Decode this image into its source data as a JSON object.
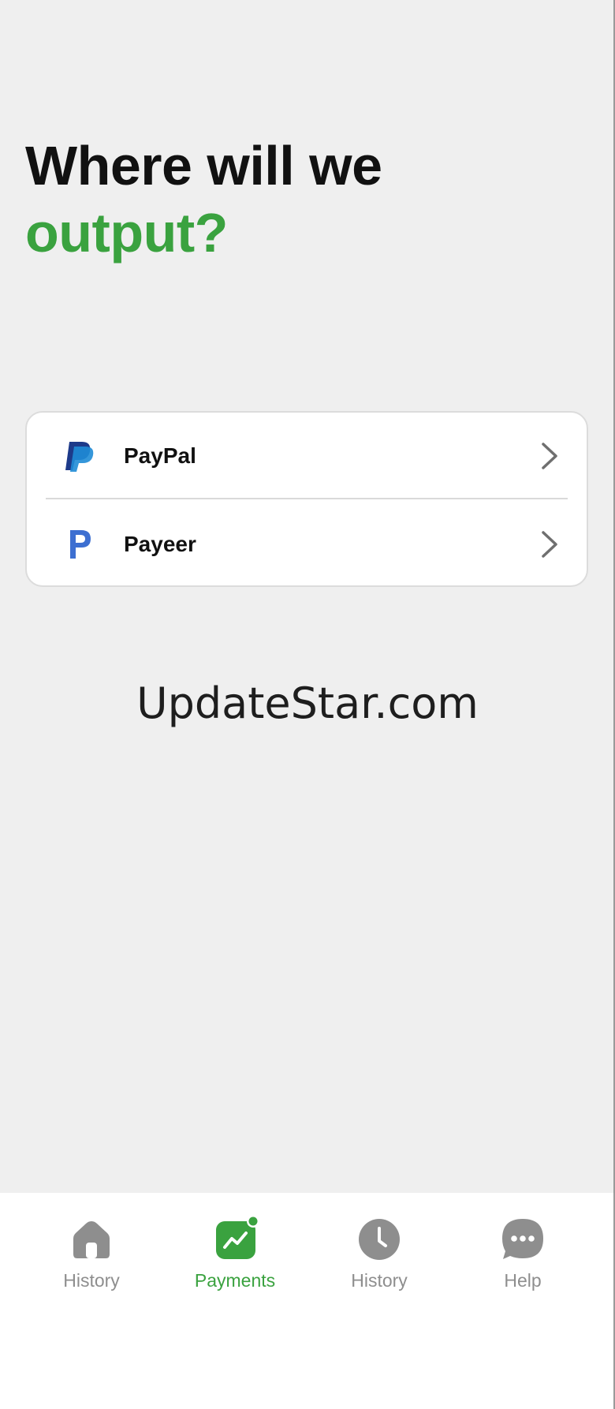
{
  "headline": {
    "line1": "Where will we",
    "line2": "output?"
  },
  "payment_methods": [
    {
      "label": "PayPal",
      "icon": "paypal-logo-icon"
    },
    {
      "label": "Payeer",
      "icon": "payeer-logo-icon"
    }
  ],
  "watermark": "UpdateStar.com",
  "bottom_nav": [
    {
      "label": "History",
      "icon": "home-icon",
      "active": false
    },
    {
      "label": "Payments",
      "icon": "chart-trend-icon",
      "active": true
    },
    {
      "label": "History",
      "icon": "clock-icon",
      "active": false
    },
    {
      "label": "Help",
      "icon": "chat-bubble-icon",
      "active": false
    }
  ],
  "colors": {
    "accent": "#3aa23f",
    "background": "#efefef",
    "paypal_dark": "#1d3a8a",
    "paypal_light": "#1f8cd6",
    "payeer_blue": "#3d6fd1",
    "nav_gray": "#8e8e8e"
  }
}
